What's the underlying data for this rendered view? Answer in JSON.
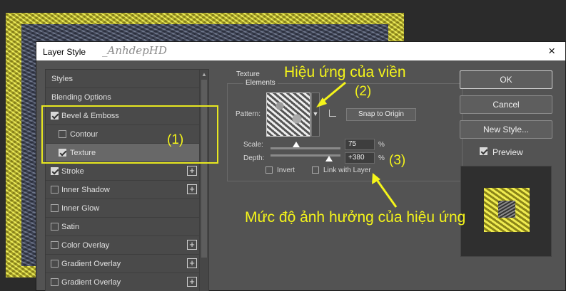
{
  "dialog": {
    "title": "Layer Style",
    "watermark": "_AnhdepHD",
    "close_icon": "×"
  },
  "styles_list": {
    "items": [
      {
        "label": "Styles",
        "type": "header"
      },
      {
        "label": "Blending Options",
        "type": "header"
      },
      {
        "label": "Bevel & Emboss",
        "checked": true
      },
      {
        "label": "Contour",
        "checked": false,
        "sub": true
      },
      {
        "label": "Texture",
        "checked": true,
        "sub": true,
        "selected": true
      },
      {
        "label": "Stroke",
        "checked": true,
        "plus": "+"
      },
      {
        "label": "Inner Shadow",
        "checked": false,
        "plus": "+"
      },
      {
        "label": "Inner Glow",
        "checked": false
      },
      {
        "label": "Satin",
        "checked": false
      },
      {
        "label": "Color Overlay",
        "checked": false,
        "plus": "+"
      },
      {
        "label": "Gradient Overlay",
        "checked": false,
        "plus": "+"
      },
      {
        "label": "Gradient Overlay",
        "checked": false,
        "plus": "+"
      }
    ]
  },
  "texture": {
    "section_title": "Texture",
    "group_title": "Elements",
    "pattern_label": "Pattern:",
    "snap_button": "Snap to Origin",
    "scale_label": "Scale:",
    "scale_value": "75",
    "scale_level": 0.37,
    "depth_label": "Depth:",
    "depth_value": "+380",
    "depth_level": 0.84,
    "unit": "%",
    "invert_label": "Invert",
    "invert_checked": false,
    "link_label": "Link with Layer",
    "link_checked": false
  },
  "right_buttons": {
    "ok": "OK",
    "cancel": "Cancel",
    "new_style": "New Style...",
    "preview_label": "Preview",
    "preview_checked": true
  },
  "annotations": {
    "label_1": "(1)",
    "label_2": "(2)",
    "label_3": "(3)",
    "top_caption": "Hiệu ứng của viền",
    "bottom_caption": "Mức độ ảnh hưởng của hiệu ứng",
    "color": "#f4f41a"
  }
}
